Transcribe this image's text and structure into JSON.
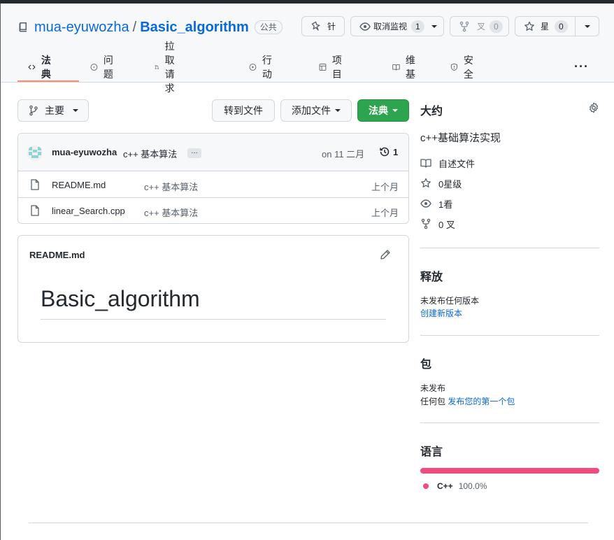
{
  "header": {
    "owner": "mua-eyuwozha",
    "separator": "/",
    "repo": "Basic_algorithm",
    "visibility": "公共",
    "pin_label": "针",
    "watch_label": "取消监视",
    "watch_count": "1",
    "fork_label": "叉",
    "fork_count": "0",
    "star_label": "星",
    "star_count": "0"
  },
  "tabs": [
    {
      "label": "法典",
      "icon": "code-icon",
      "active": true
    },
    {
      "label": "问题",
      "icon": "issue-icon"
    },
    {
      "label": "拉取请求",
      "icon": "pull-request-icon"
    },
    {
      "label": "行动",
      "icon": "play-icon"
    },
    {
      "label": "项目",
      "icon": "table-icon"
    },
    {
      "label": "维基",
      "icon": "book-icon"
    },
    {
      "label": "安全",
      "icon": "shield-icon"
    }
  ],
  "toolbar": {
    "branch": "主要",
    "goto_file": "转到文件",
    "add_file": "添加文件",
    "code": "法典"
  },
  "commit": {
    "author": "mua-eyuwozha",
    "message": "c++ 基本算法",
    "ellipsis": "…",
    "date": "on 11 二月",
    "history_count": "1"
  },
  "files": [
    {
      "name": "README.md",
      "message": "c++ 基本算法",
      "age": "上个月"
    },
    {
      "name": "linear_Search.cpp",
      "message": "c++ 基本算法",
      "age": "上个月"
    }
  ],
  "readme": {
    "filename": "README.md",
    "heading": "Basic_algorithm"
  },
  "sidebar": {
    "about_title": "大约",
    "description": "c++基础算法实现",
    "readme_label": "自述文件",
    "stars": "0星级",
    "watching": "1看",
    "forks": "0 叉",
    "releases_title": "释放",
    "releases_text": "未发布任何版本",
    "releases_link": "创建新版本",
    "packages_title": "包",
    "packages_text1": "未发布",
    "packages_text2": "任何包",
    "packages_link": "发布您的第一个包",
    "languages_title": "语言",
    "language_name": "C++",
    "language_pct": "100.0%",
    "language_color": "#f34b7d"
  }
}
